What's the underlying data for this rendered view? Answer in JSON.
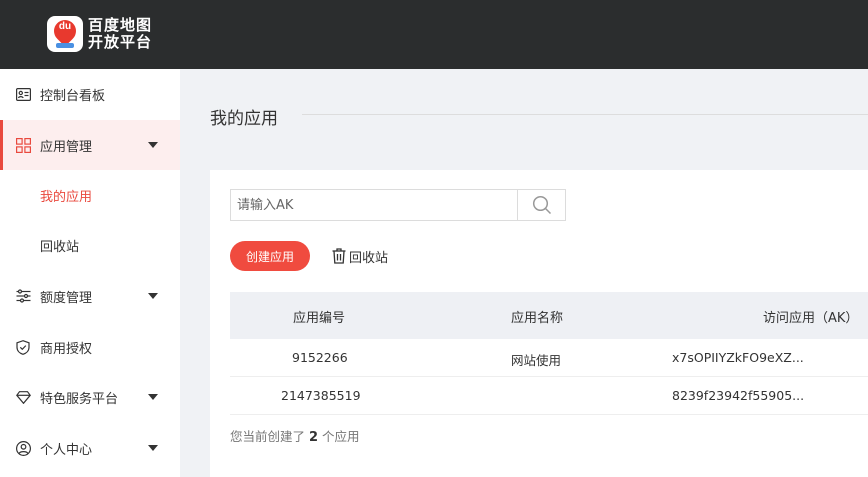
{
  "brand": {
    "line1": "百度地图",
    "line2": "开放平台",
    "badge_text": "du",
    "accent": "#e9493e"
  },
  "sidebar": {
    "items": [
      {
        "label": "控制台看板",
        "icon": "id-card-icon"
      },
      {
        "label": "应用管理",
        "icon": "grid-icon",
        "expanded": true
      },
      {
        "label": "我的应用",
        "sub": true,
        "selected": true
      },
      {
        "label": "回收站",
        "sub": true
      },
      {
        "label": "额度管理",
        "icon": "sliders-icon"
      },
      {
        "label": "商用授权",
        "icon": "shield-check-icon"
      },
      {
        "label": "特色服务平台",
        "icon": "diamond-icon"
      },
      {
        "label": "个人中心",
        "icon": "user-circle-icon"
      }
    ]
  },
  "main": {
    "title": "我的应用",
    "search": {
      "placeholder": "请输入AK",
      "value": ""
    },
    "create_label": "创建应用",
    "recycle_label": "回收站",
    "table": {
      "columns": [
        "应用编号",
        "应用名称",
        "访问应用（AK）"
      ],
      "rows": [
        {
          "id": "9152266",
          "name": "网站使用",
          "ak": "x7sOPIIYZkFO9eXZ..."
        },
        {
          "id": "2147385519",
          "name": "",
          "ak": "8239f23942f55905..."
        }
      ]
    },
    "footer": {
      "prefix": "您当前创建了",
      "count": "2",
      "suffix": "个应用"
    }
  }
}
